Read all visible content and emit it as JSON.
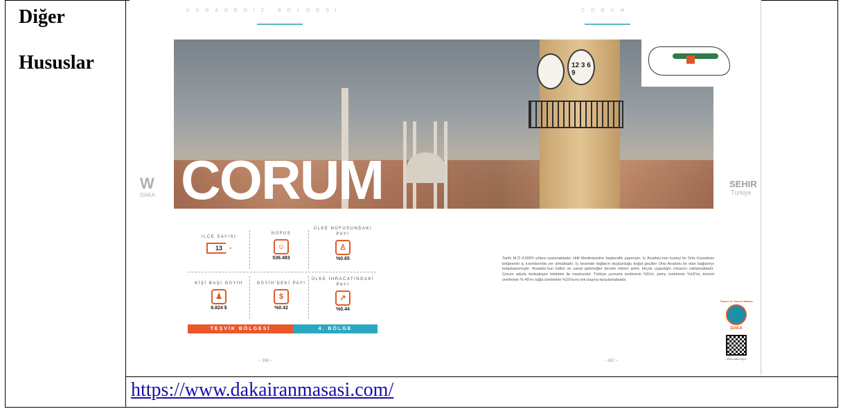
{
  "left_cell": {
    "line1": "Diğer",
    "line2": "Hususlar"
  },
  "link": {
    "url_text": "https://www.dakairanmasasi.com/"
  },
  "spread": {
    "header_left": "KARADENIZ BÖLGESI",
    "header_right": "CORUM",
    "big_title": "CORUM",
    "clock_numerals": "12 3 6 9",
    "left_logo": {
      "mark": "W",
      "text": "DAKA"
    },
    "right_logo": {
      "mark": "SEHIR",
      "sub": "Türkiye"
    },
    "stats": [
      {
        "label": "ILCE SAYISI",
        "value": "13",
        "icon": "arrow-sign-icon"
      },
      {
        "label": "NÜFUS",
        "value": "536.483",
        "icon": "people-icon"
      },
      {
        "label": "ÜLKE NÜFUSUNDAKI PAYI",
        "value": "%0.65",
        "icon": "population-icon"
      },
      {
        "label": "KİŞİ BAŞI GSYİH",
        "value": "6.824 $",
        "icon": "person-icon"
      },
      {
        "label": "GSYİH'DEKİ PAYI",
        "value": "%0.42",
        "icon": "money-bag-icon"
      },
      {
        "label": "ÜLKE İHRACATINDAKİ PAYI",
        "value": "%0.44",
        "icon": "export-icon"
      }
    ],
    "bar_left": "TEŞVİK BÖLGESİ",
    "bar_right": "4. BÖLGE",
    "paragraph": "Tarihi M.Ö 4.000'li yıllara uzanmaktadır. Hitit Medeniyetine başkentlik yapmıştır. İç Anadolu'nun kuzeyi ile Orta Karadeniz bölgesinin iç kısımlarında yer almaktadır. İç kesimde dağların oluşturduğu doğal geçitler Orta Anadolu ile olan bağlantıyı kolaylaştırmıştır. Anadolu'nun kültür ve sanat geleneğini devam ettiren şehir, birçok uygarlığın mirasını saklamaktadır. Çorum adıyla özdeşleşen leblebisi ile meşhurdur. Türkiye yumurta üretiminin %5'ini, pirinç üretiminin %18'ini, kiremit üretiminin % 40'ını tuğla üretiminin %10'nunu tek başına karşılamaktadır.",
    "page_left": "~ 386 ~",
    "page_right": "~ 387 ~",
    "badge": {
      "top": "Ticaret ve Yatırım Masası",
      "name": "DAKA",
      "url": "www.daka.org.tr"
    },
    "colors": {
      "orange": "#e9572b",
      "teal": "#2aa8c2"
    }
  }
}
